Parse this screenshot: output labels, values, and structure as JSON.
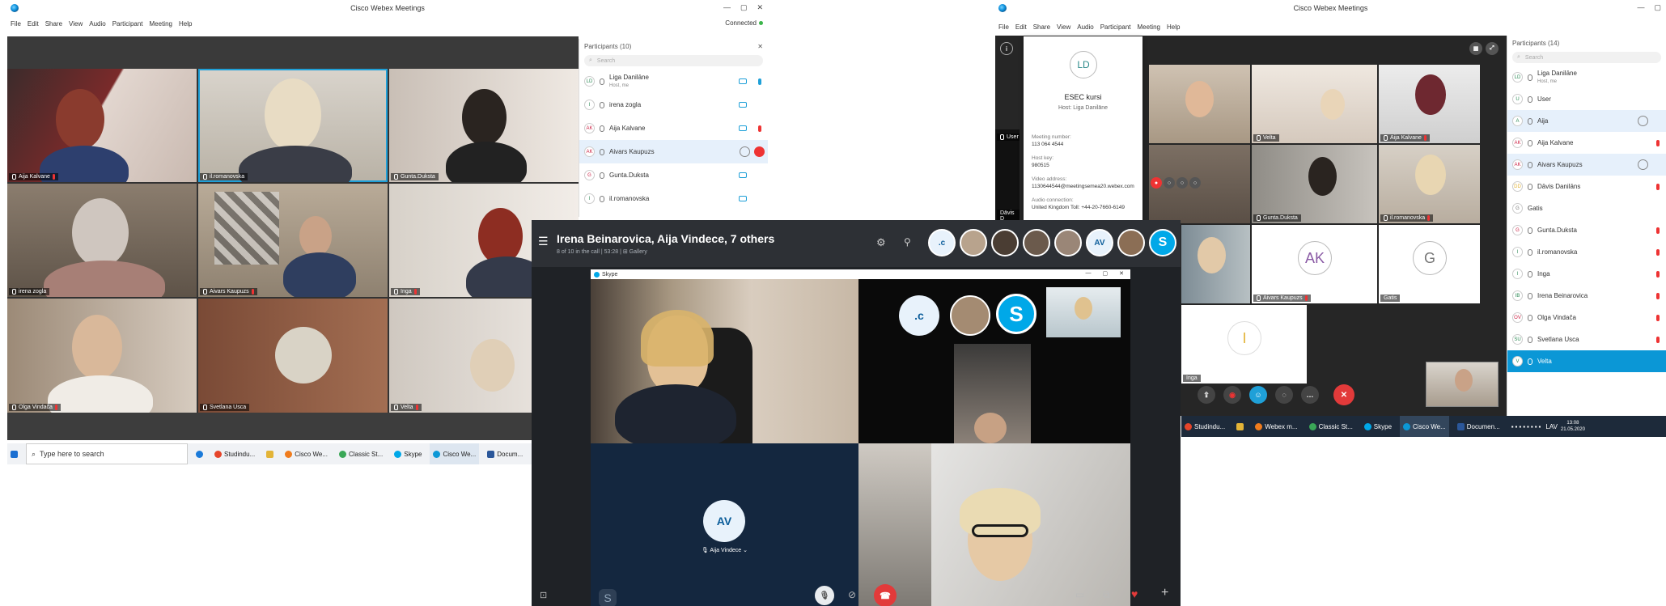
{
  "left_window": {
    "title": "Cisco Webex Meetings",
    "window_controls": [
      "—",
      "▢",
      "✕"
    ],
    "menu": [
      "File",
      "Edit",
      "Share",
      "View",
      "Audio",
      "Participant",
      "Meeting",
      "Help"
    ],
    "status": "Connected",
    "tiles": [
      {
        "name": "Aija Kalvane",
        "muted": true
      },
      {
        "name": "il.romanovska",
        "muted": false
      },
      {
        "name": "Gunta.Duksta",
        "muted": false
      },
      {
        "name": "irena zogla",
        "muted": false
      },
      {
        "name": "Aivars Kaupuzs",
        "muted": true
      },
      {
        "name": "Inga",
        "muted": true
      },
      {
        "name": "Olga Vindača",
        "muted": true
      },
      {
        "name": "Svetlana Usca",
        "muted": false
      },
      {
        "name": "Velta",
        "muted": true
      }
    ],
    "participants_title": "Participants (10)",
    "close_symbol": "✕",
    "search_placeholder": "Search",
    "participants": [
      {
        "initials": "LD",
        "name": "Liga  Danilāne",
        "sub": "Host, me"
      },
      {
        "initials": "I",
        "name": "irena zogla",
        "sub": ""
      },
      {
        "initials": "AK",
        "name": "Aija Kalvane",
        "sub": ""
      },
      {
        "initials": "AK",
        "name": "Aivars Kaupuzs",
        "sub": ""
      },
      {
        "initials": "G",
        "name": "Gunta.Duksta",
        "sub": ""
      },
      {
        "initials": "I",
        "name": "il.romanovska",
        "sub": ""
      }
    ],
    "taskbar": {
      "search": "Type here to search",
      "apps": [
        "Studindu...",
        "Cisco We...",
        "Classic St...",
        "Skype",
        "Cisco We...",
        "Docum..."
      ]
    }
  },
  "right_window": {
    "title": "Cisco Webex Meetings",
    "window_controls": [
      "—",
      "▢"
    ],
    "menu": [
      "File",
      "Edit",
      "Share",
      "View",
      "Audio",
      "Participant",
      "Meeting",
      "Help"
    ],
    "popup": {
      "initials": "LD",
      "meeting_name": "ESEC kursi",
      "host_label": "Host:",
      "host": "Liga  Danilāne",
      "fields": [
        {
          "label": "Meeting number:",
          "value": "113 064 4544"
        },
        {
          "label": "Host key:",
          "value": "980515"
        },
        {
          "label": "Video address:",
          "value": "1130644544@meetingsemea20.webex.com"
        },
        {
          "label": "Audio connection:",
          "value": "United Kingdom Toll: +44-20-7660-6149"
        }
      ]
    },
    "user_label": "User",
    "partial_label": "Dāvis D",
    "tiles": [
      {
        "name": "",
        "muted": false
      },
      {
        "name": "Velta",
        "muted": false
      },
      {
        "name": "Aija Kalvane",
        "muted": true
      },
      {
        "name": "",
        "muted": false
      },
      {
        "name": "Gunta.Duksta",
        "muted": false
      },
      {
        "name": "il.romanovska",
        "muted": true
      },
      {
        "name": "",
        "muted": false
      },
      {
        "name": "Aivars Kaupuzs",
        "muted": true,
        "initials": "AK"
      },
      {
        "name": "Gatis",
        "muted": false,
        "initials": "G"
      },
      {
        "name": "Inga",
        "muted": false,
        "initials": "I"
      }
    ],
    "participants_title": "Participants (14)",
    "search_placeholder": "Search",
    "participants": [
      {
        "initials": "LD",
        "name": "Liga  Danilāne",
        "sub": "Host, me",
        "state": ""
      },
      {
        "initials": "U",
        "name": "User",
        "sub": "",
        "state": ""
      },
      {
        "initials": "A",
        "name": "Aija",
        "sub": "",
        "state": "selected"
      },
      {
        "initials": "AK",
        "name": "Aija Kalvane",
        "sub": "",
        "state": ""
      },
      {
        "initials": "AK",
        "name": "Aivars Kaupuzs",
        "sub": "",
        "state": ""
      },
      {
        "initials": "DD",
        "name": "Dāvis Danilāns",
        "sub": "",
        "state": ""
      },
      {
        "initials": "G",
        "name": "Gatis",
        "sub": "",
        "state": ""
      },
      {
        "initials": "G",
        "name": "Gunta.Duksta",
        "sub": "",
        "state": ""
      },
      {
        "initials": "I",
        "name": "il.romanovska",
        "sub": "",
        "state": ""
      },
      {
        "initials": "I",
        "name": "Inga",
        "sub": "",
        "state": ""
      },
      {
        "initials": "IB",
        "name": "Irena Beinarovica",
        "sub": "",
        "state": ""
      },
      {
        "initials": "OV",
        "name": "Olga Vindača",
        "sub": "",
        "state": ""
      },
      {
        "initials": "SU",
        "name": "Svetlana Usca",
        "sub": "",
        "state": ""
      },
      {
        "initials": "V",
        "name": "Velta",
        "sub": "",
        "state": "highlight"
      }
    ],
    "taskbar": {
      "apps": [
        "Studindu...",
        "Webex m...",
        "Classic St...",
        "Skype",
        "Cisco We...",
        "Documen..."
      ],
      "language": "LAV",
      "time": "13:08",
      "date": "21.05.2020"
    }
  },
  "skype": {
    "title": "Irena Beinarovica, Aija Vindece, 7 others",
    "subtitle": "8 of 10 in the call | 53:28 | ⊞ Gallery",
    "avatars": [
      ".c",
      "",
      "",
      "",
      "",
      "AV",
      "",
      "S"
    ],
    "inner_window_title": "Skype",
    "inner_window_controls": [
      "—",
      "▢",
      "✕"
    ],
    "inner_avatar_c": ".c",
    "av_tile_initials": "AV",
    "av_tile_label": "Aija Vindece"
  },
  "colors": {
    "webex_blue": "#0b97d6",
    "end_call_red": "#e23a3a",
    "skype_blue": "#00a8e8"
  }
}
